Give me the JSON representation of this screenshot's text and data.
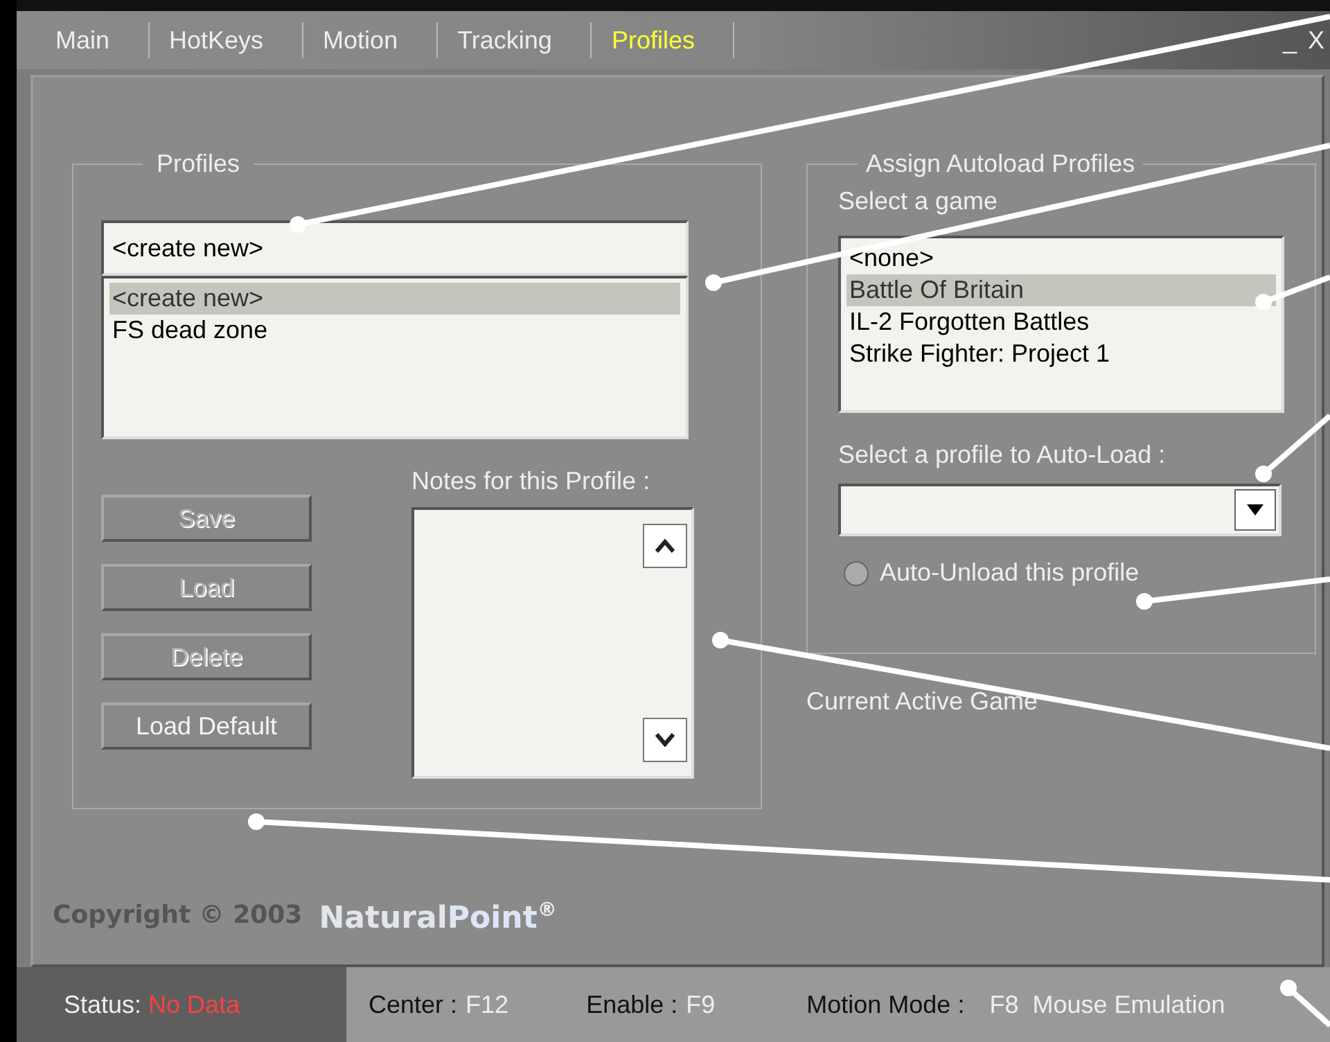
{
  "tabs": [
    {
      "label": "Main",
      "selected": false
    },
    {
      "label": "HotKeys",
      "selected": false
    },
    {
      "label": "Motion",
      "selected": false
    },
    {
      "label": "Tracking",
      "selected": false
    },
    {
      "label": "Profiles",
      "selected": true
    }
  ],
  "window_controls": [
    "_",
    "X"
  ],
  "profiles": {
    "title": "Profiles",
    "name_field": {
      "value": "<create new>"
    },
    "items": [
      {
        "label": "<create new>",
        "selected": true
      },
      {
        "label": "FS dead zone",
        "selected": false
      }
    ],
    "buttons": [
      {
        "label": "Save",
        "disabled": true
      },
      {
        "label": "Load",
        "disabled": true
      },
      {
        "label": "Delete",
        "disabled": true
      },
      {
        "label": "Load Default",
        "disabled": false
      }
    ],
    "notes_label": "Notes for this Profile :"
  },
  "autoload": {
    "title": "Assign Autoload Profiles",
    "game_label": "Select a game",
    "games": [
      {
        "label": "<none>",
        "selected": false
      },
      {
        "label": "Battle Of Britain",
        "selected": true
      },
      {
        "label": "IL-2 Forgotten Battles",
        "selected": false
      },
      {
        "label": "Strike Fighter: Project 1",
        "selected": false
      }
    ],
    "profile_label": "Select a profile to Auto-Load :",
    "auto_unload": {
      "label": "Auto-Unload this profile",
      "checked": false
    }
  },
  "current_game_label": "Current Active Game",
  "copyright": {
    "text": "Copyright © 2003",
    "brand_first": "Natural",
    "brand_second": "Point",
    "mark": "®"
  },
  "status_bar": {
    "status_label": "Status:",
    "status_value": "No Data",
    "center_label": "Center :",
    "center_value": "F12",
    "enable_label": "Enable :",
    "enable_value": "F9",
    "mode_label": "Motion Mode :",
    "mode_value": "F8  Mouse Emulation"
  },
  "annotations": [
    {
      "kind": "leader"
    },
    {
      "kind": "leader"
    },
    {
      "kind": "leader"
    },
    {
      "kind": "leader"
    },
    {
      "kind": "leader"
    },
    {
      "kind": "leader"
    },
    {
      "kind": "leader"
    },
    {
      "kind": "leader"
    }
  ]
}
